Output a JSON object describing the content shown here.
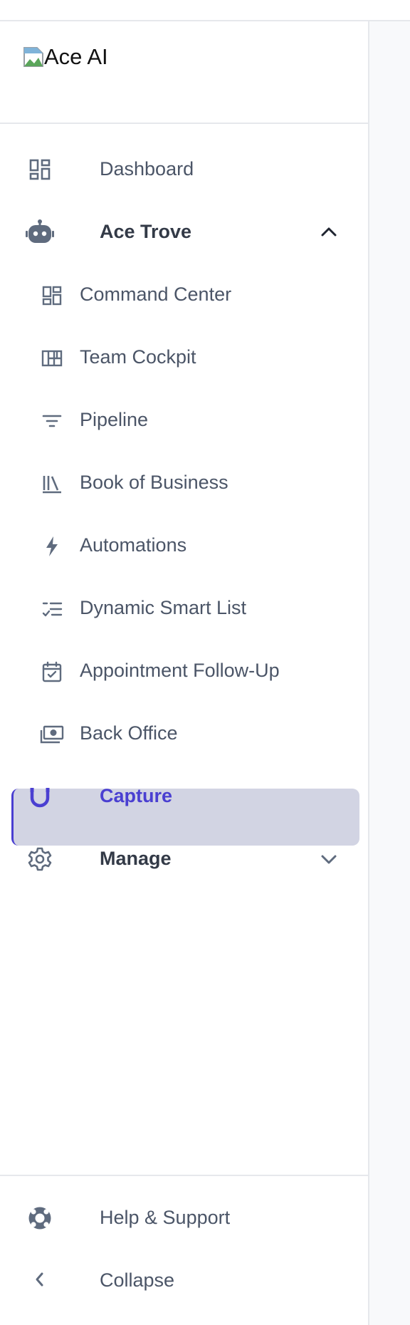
{
  "logo": {
    "alt_text": "Ace AI"
  },
  "nav": {
    "dashboard": {
      "label": "Dashboard",
      "icon": "dashboard-icon"
    },
    "ace_trove": {
      "label": "Ace Trove",
      "icon": "robot-icon",
      "expanded": true
    },
    "sub_items": [
      {
        "label": "Command Center",
        "icon": "command-center-icon"
      },
      {
        "label": "Team Cockpit",
        "icon": "team-cockpit-icon"
      },
      {
        "label": "Pipeline",
        "icon": "filter-icon"
      },
      {
        "label": "Book of Business",
        "icon": "books-icon"
      },
      {
        "label": "Automations",
        "icon": "bolt-icon"
      },
      {
        "label": "Dynamic Smart List",
        "icon": "checklist-icon"
      },
      {
        "label": "Appointment Follow-Up",
        "icon": "calendar-check-icon"
      },
      {
        "label": "Back Office",
        "icon": "money-icon"
      }
    ],
    "capture": {
      "label": "Capture",
      "icon": "magnet-icon",
      "active": true
    },
    "manage": {
      "label": "Manage",
      "icon": "gear-icon",
      "expanded": false
    }
  },
  "footer": {
    "help": {
      "label": "Help & Support",
      "icon": "lifebuoy-icon"
    },
    "collapse": {
      "label": "Collapse",
      "icon": "chevron-left-icon"
    }
  },
  "colors": {
    "accent": "#4a3fd1",
    "active_bg": "#d2d4e3",
    "text": "#4b5567",
    "text_bold": "#333a47"
  }
}
